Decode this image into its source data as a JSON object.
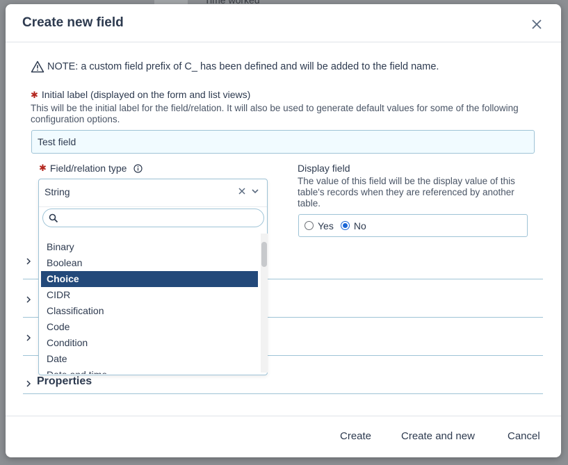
{
  "background": {
    "peek_text": "Time worked"
  },
  "modal": {
    "title": "Create new field",
    "note": "NOTE: a custom field prefix of C_ has been defined and will be added to the field name.",
    "initial_label": {
      "required_mark": "✱",
      "label": "Initial label (displayed on the form and list views)",
      "help": "This will be the initial label for the field/relation. It will also be used to generate default values for some of the following configuration options.",
      "value": "Test field"
    },
    "field_type": {
      "required_mark": "✱",
      "label": "Field/relation type",
      "selected": "String",
      "search_placeholder": "",
      "options": [
        "Binary",
        "Boolean",
        "Choice",
        "CIDR",
        "Classification",
        "Code",
        "Condition",
        "Date",
        "Date and time"
      ],
      "highlighted": "Choice"
    },
    "display_field": {
      "label": "Display field",
      "help": "The value of this field will be the display value of this table's records when they are referenced by another table.",
      "yes": "Yes",
      "no": "No",
      "selected": "No"
    },
    "sections": [
      "Properties"
    ],
    "footer": {
      "create": "Create",
      "create_and_new": "Create and new",
      "cancel": "Cancel"
    }
  },
  "colors": {
    "accent": "#23497a",
    "radio": "#1a66d6",
    "required": "#b3261e",
    "input_border": "#9ec3d6"
  }
}
